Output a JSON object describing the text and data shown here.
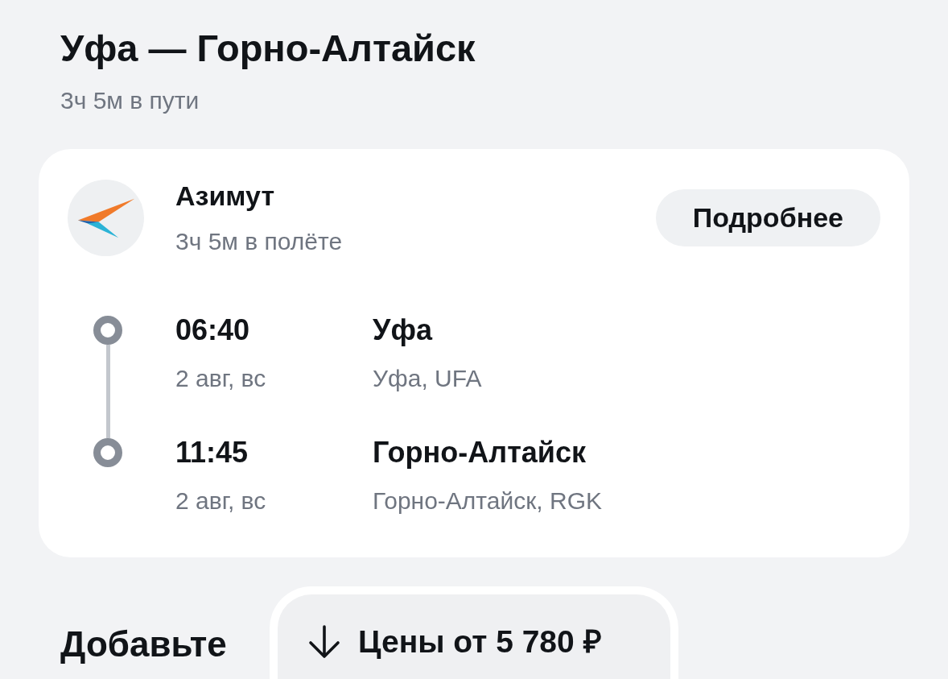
{
  "header": {
    "title": "Уфа — Горно-Алтайск",
    "subtitle": "3ч 5м в пути"
  },
  "flight": {
    "airline": "Азимут",
    "duration": "3ч 5м в полёте",
    "details_button": "Подробнее",
    "stops": [
      {
        "time": "06:40",
        "date": "2 авг, вс",
        "city": "Уфа",
        "airport": "Уфа, UFA"
      },
      {
        "time": "11:45",
        "date": "2 авг, вс",
        "city": "Горно-Алтайск",
        "airport": "Горно-Алтайск, RGK"
      }
    ]
  },
  "section_title": "Добавьте",
  "price_button": {
    "label": "Цены от 5 780 ₽"
  }
}
